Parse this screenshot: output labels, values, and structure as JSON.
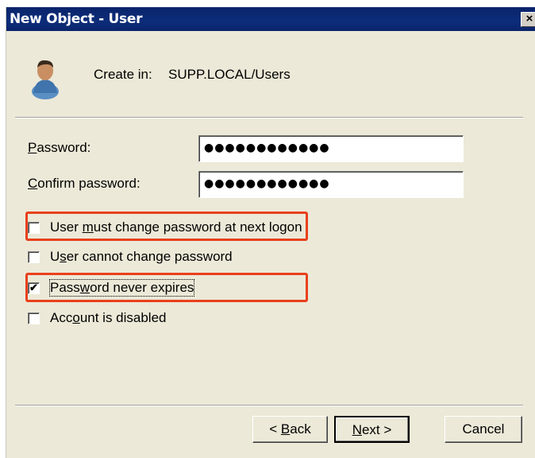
{
  "window": {
    "title": "New Object - User",
    "close_glyph": "×"
  },
  "header": {
    "create_in_label": "Create in:",
    "create_in_path": "SUPP.LOCAL/Users",
    "icon": "user-icon"
  },
  "fields": {
    "password": {
      "label_mnemonic": "P",
      "label_rest": "assword:",
      "value": "●●●●●●●●●●●●"
    },
    "confirm": {
      "label_mnemonic": "C",
      "label_rest": "onfirm password:",
      "value": "●●●●●●●●●●●●"
    }
  },
  "options": {
    "must_change": {
      "pre": "User ",
      "mnemonic": "m",
      "post": "ust change password at next logon",
      "checked": false,
      "mark": ""
    },
    "cannot_change": {
      "pre": "U",
      "mnemonic": "s",
      "post": "er cannot change password",
      "checked": false,
      "mark": ""
    },
    "never_expires": {
      "pre": "Pass",
      "mnemonic": "w",
      "post": "ord never expires",
      "checked": true,
      "mark": "✔"
    },
    "disabled": {
      "pre": "Acc",
      "mnemonic": "o",
      "post": "unt is disabled",
      "checked": false,
      "mark": ""
    }
  },
  "buttons": {
    "back": {
      "pre": "< ",
      "mnemonic": "B",
      "post": "ack"
    },
    "next": {
      "pre": "",
      "mnemonic": "N",
      "post": "ext >"
    },
    "cancel": {
      "label": "Cancel"
    }
  },
  "colors": {
    "highlight": "#e8401c",
    "titlebar": "#0a246a",
    "dialog_bg": "#ece9d8"
  }
}
